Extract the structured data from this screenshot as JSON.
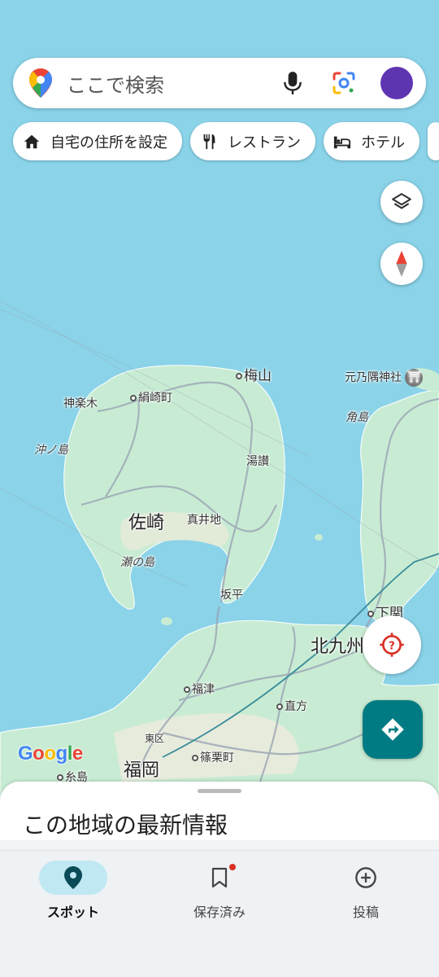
{
  "search": {
    "placeholder": "ここで検索"
  },
  "chips": [
    {
      "label": "自宅の住所を設定",
      "icon": "home-icon"
    },
    {
      "label": "レストラン",
      "icon": "restaurant-icon"
    },
    {
      "label": "ホテル",
      "icon": "hotel-icon"
    }
  ],
  "map": {
    "labels": {
      "umeyama": "梅山",
      "motonosumi": "元乃隅神社",
      "kinugasa": "絹崎町",
      "kagurago": "神楽木",
      "tsunoshima": "角島",
      "okinoshima": "沖ノ島",
      "yusan": "湯讃",
      "sakizaki": "佐崎",
      "maichi": "真井地",
      "senoshima": "瀬の島",
      "sakahira": "坂平",
      "shimonoseki": "下関",
      "kitakyushu": "北九州",
      "fukutsu": "福津",
      "nogata": "直方",
      "higashiku": "東区",
      "sasaguri": "篠栗町",
      "fukuoka": "福岡",
      "itoshima": "糸島"
    },
    "google_logo": "Google"
  },
  "sheet": {
    "title": "この地域の最新情報"
  },
  "nav": {
    "spots": "スポット",
    "saved": "保存済み",
    "post": "投稿"
  },
  "colors": {
    "sea": "#8ad3e9",
    "land": "#c8ecd3",
    "accent": "#007b83",
    "avatar": "#5e35b1"
  }
}
